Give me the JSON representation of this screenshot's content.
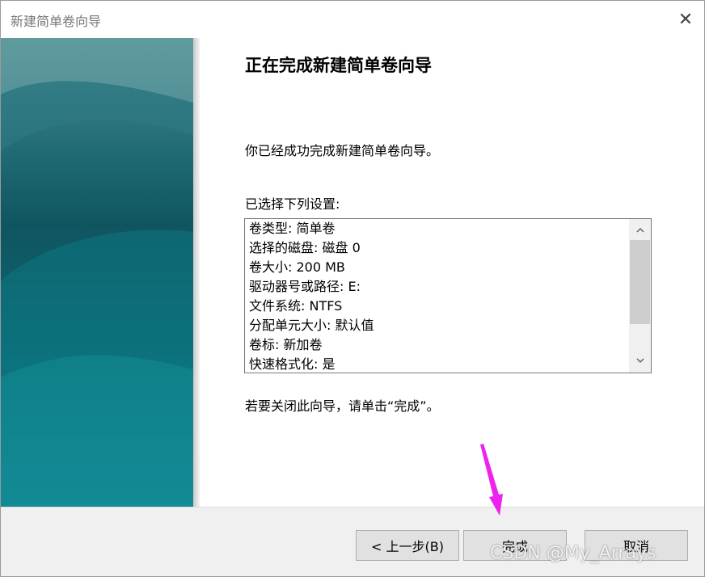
{
  "window": {
    "title": "新建简单卷向导",
    "close_glyph": "✕"
  },
  "content": {
    "heading": "正在完成新建简单卷向导",
    "success_text": "你已经成功完成新建简单卷向导。",
    "settings_label": "已选择下列设置:",
    "settings": [
      "卷类型: 简单卷",
      "选择的磁盘: 磁盘 0",
      "卷大小: 200 MB",
      "驱动器号或路径: E:",
      "文件系统: NTFS",
      "分配单元大小: 默认值",
      "卷标: 新加卷",
      "快速格式化: 是"
    ],
    "close_hint": "若要关闭此向导，请单击“完成”。"
  },
  "buttons": {
    "back": "< 上一步(B)",
    "finish": "完成",
    "cancel": "取消"
  },
  "annotation": {
    "arrow_color": "#ee22ee"
  },
  "watermark": "CSDN @My_Arrays"
}
